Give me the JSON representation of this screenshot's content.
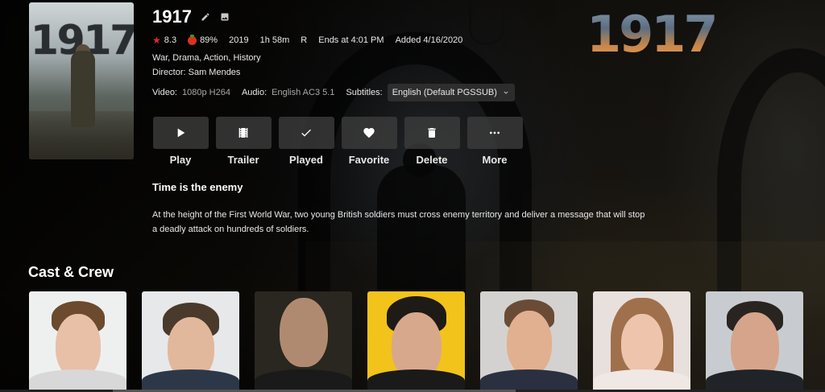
{
  "movie": {
    "title": "1917",
    "logo_text": "1917",
    "poster_text": "1917",
    "community_rating": "8.3",
    "critic_rating": "89%",
    "year": "2019",
    "runtime": "1h 58m",
    "rating": "R",
    "ends_at": "Ends at 4:01 PM",
    "added": "Added 4/16/2020",
    "genres": "War, Drama, Action, History",
    "director": "Director: Sam Mendes",
    "tagline": "Time is the enemy",
    "overview": "At the height of the First World War, two young British soldiers must cross enemy territory and deliver a message that will stop a deadly attack on hundreds of soldiers."
  },
  "tech": {
    "video_label": "Video:",
    "video_value": "1080p H264",
    "audio_label": "Audio:",
    "audio_value": "English AC3 5.1",
    "subtitles_label": "Subtitles:",
    "subtitles_value": "English (Default PGSSUB)"
  },
  "actions": [
    {
      "label": "Play",
      "icon": "play-icon"
    },
    {
      "label": "Trailer",
      "icon": "film-icon"
    },
    {
      "label": "Played",
      "icon": "check-icon"
    },
    {
      "label": "Favorite",
      "icon": "heart-icon"
    },
    {
      "label": "Delete",
      "icon": "trash-icon"
    },
    {
      "label": "More",
      "icon": "more-icon"
    }
  ],
  "cast": {
    "heading": "Cast & Crew"
  },
  "colors": {
    "star": "#e12a2a",
    "tomato": "#d9331c",
    "button_bg": "#3c3c3c"
  }
}
